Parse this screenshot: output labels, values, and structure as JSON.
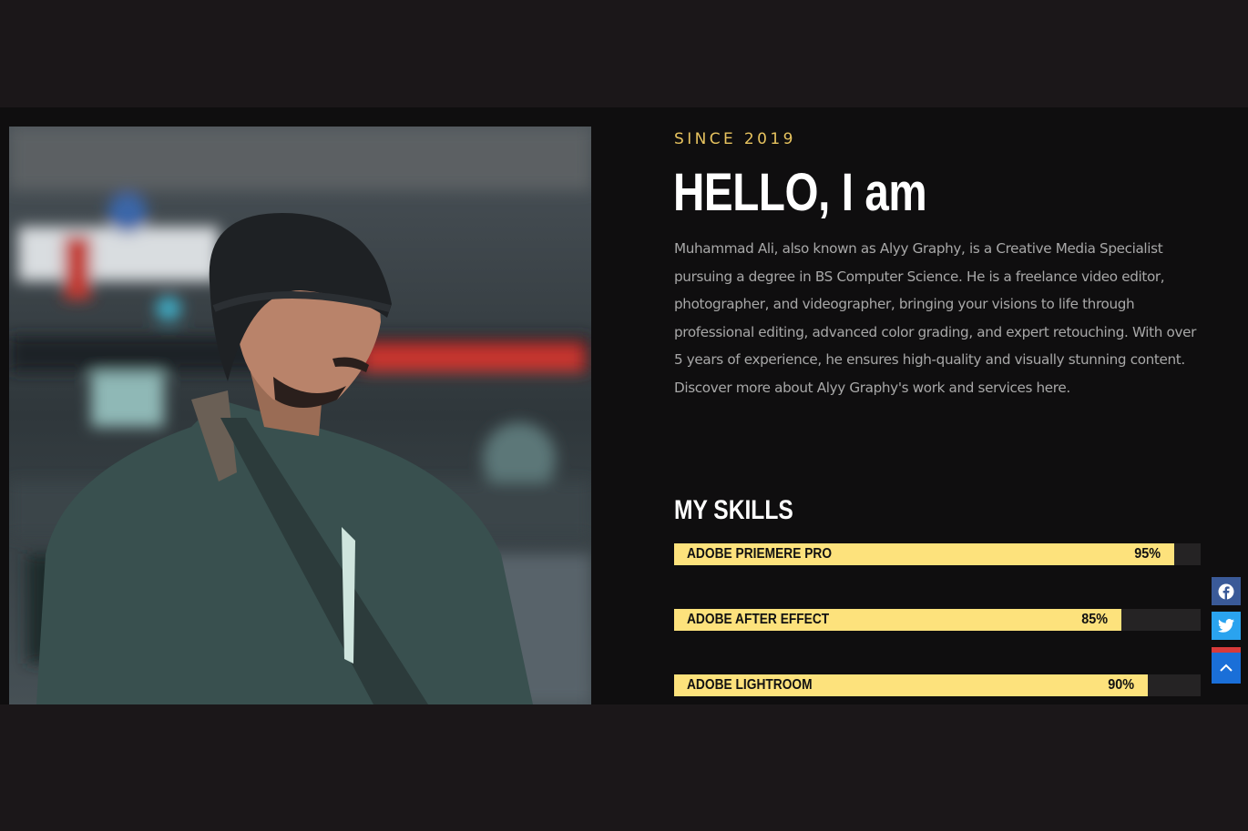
{
  "hero": {
    "eyebrow": "SINCE 2019",
    "heading": "HELLO, I am",
    "bio": "Muhammad Ali, also known as Alyy Graphy, is a Creative Media Specialist pursuing a degree in BS Computer Science. He is a freelance video editor, photographer, and videographer, bringing your visions to life through professional editing, advanced color grading, and expert retouching. With over 5 years of experience, he ensures high-quality and visually stunning content. Discover more about Alyy Graphy's work and services here."
  },
  "skills": {
    "title": "MY SKILLS",
    "items": [
      {
        "label": "ADOBE PRIEMERE PRO",
        "percent_label": "95%",
        "percent": 95
      },
      {
        "label": "ADOBE AFTER EFFECT",
        "percent_label": "85%",
        "percent": 85
      },
      {
        "label": "ADOBE LIGHTROOM",
        "percent_label": "90%",
        "percent": 90
      }
    ]
  },
  "colors": {
    "accent": "#e7c35f",
    "bar_fill": "#fde27c",
    "background": "#0f0e0f",
    "facebook": "#3a5a98",
    "twitter": "#2aa3ef",
    "scroll_top": "#1a6fd8"
  },
  "floating": {
    "facebook_icon": "facebook-icon",
    "twitter_icon": "twitter-icon",
    "scroll_top_icon": "chevron-up-icon"
  }
}
